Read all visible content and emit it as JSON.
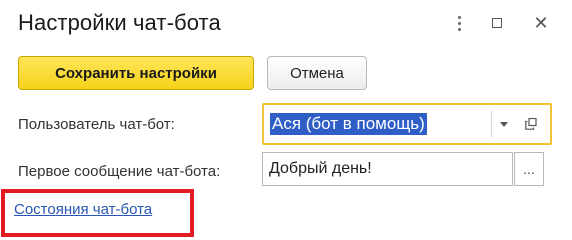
{
  "window": {
    "title": "Настройки чат-бота",
    "controls": {
      "more_icon": "vertical-dots-icon",
      "maximize_icon": "maximize-icon",
      "close_icon": "close-icon",
      "close_glyph": "✕"
    }
  },
  "toolbar": {
    "save_label": "Сохранить настройки",
    "cancel_label": "Отмена",
    "save_color": "#f5d21a"
  },
  "form": {
    "user_label": "Пользователь чат-бот:",
    "user_value": "Ася (бот в помощь)",
    "user_value_selected": true,
    "user_field_border_color": "#f1c232",
    "first_message_label": "Первое сообщение чат-бота:",
    "first_message_value": "Добрый день!",
    "first_message_button": "..."
  },
  "links": {
    "states_label": "Состояния чат-бота",
    "highlight_color": "#e01b22"
  }
}
